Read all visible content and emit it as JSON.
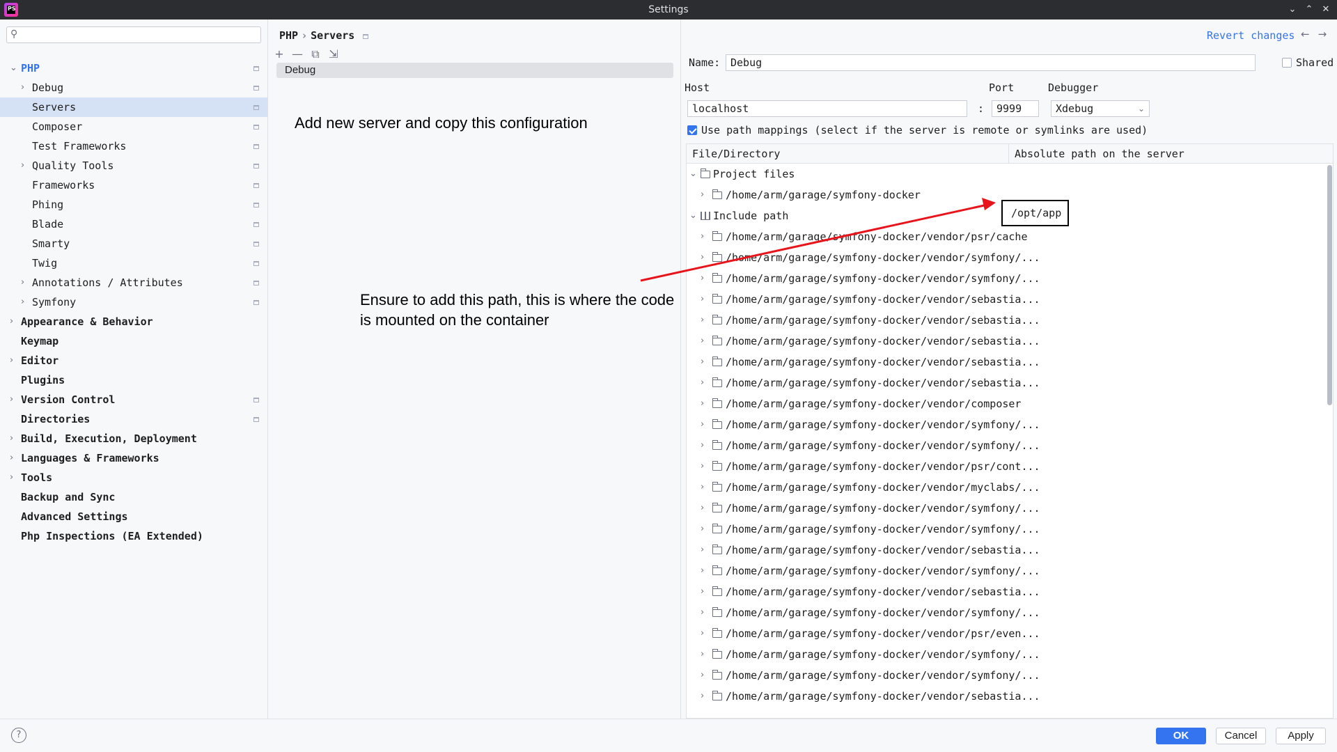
{
  "window": {
    "title": "Settings",
    "app_icon_text": "PS",
    "controls": [
      "⌄",
      "⌃",
      "✕"
    ]
  },
  "sidebar": {
    "search_placeholder": "",
    "items": [
      {
        "label": "PHP",
        "expanded": true,
        "level": 0,
        "style": "accent",
        "pinned": true
      },
      {
        "label": "Debug",
        "expandable": true,
        "level": 1,
        "pinned": true
      },
      {
        "label": "Servers",
        "level": 1,
        "selected": true,
        "pinned": true
      },
      {
        "label": "Composer",
        "level": 1,
        "pinned": true
      },
      {
        "label": "Test Frameworks",
        "level": 1,
        "pinned": true
      },
      {
        "label": "Quality Tools",
        "expandable": true,
        "level": 1,
        "pinned": true
      },
      {
        "label": "Frameworks",
        "level": 1,
        "pinned": true
      },
      {
        "label": "Phing",
        "level": 1,
        "pinned": true
      },
      {
        "label": "Blade",
        "level": 1,
        "pinned": true
      },
      {
        "label": "Smarty",
        "level": 1,
        "pinned": true
      },
      {
        "label": "Twig",
        "level": 1,
        "pinned": true
      },
      {
        "label": "Annotations / Attributes",
        "expandable": true,
        "level": 1,
        "pinned": true
      },
      {
        "label": "Symfony",
        "expandable": true,
        "level": 1,
        "pinned": true
      },
      {
        "label": "Appearance & Behavior",
        "expandable": true,
        "level": 0,
        "style": "bold"
      },
      {
        "label": "Keymap",
        "level": 0,
        "style": "bold"
      },
      {
        "label": "Editor",
        "expandable": true,
        "level": 0,
        "style": "bold"
      },
      {
        "label": "Plugins",
        "level": 0,
        "style": "bold"
      },
      {
        "label": "Version Control",
        "expandable": true,
        "level": 0,
        "style": "bold",
        "pinned": true
      },
      {
        "label": "Directories",
        "level": 0,
        "style": "bold",
        "pinned": true
      },
      {
        "label": "Build, Execution, Deployment",
        "expandable": true,
        "level": 0,
        "style": "bold"
      },
      {
        "label": "Languages & Frameworks",
        "expandable": true,
        "level": 0,
        "style": "bold"
      },
      {
        "label": "Tools",
        "expandable": true,
        "level": 0,
        "style": "bold"
      },
      {
        "label": "Backup and Sync",
        "level": 0,
        "style": "bold"
      },
      {
        "label": "Advanced Settings",
        "level": 0,
        "style": "bold"
      },
      {
        "label": "Php Inspections (EA Extended)",
        "level": 0,
        "style": "bold"
      }
    ]
  },
  "breadcrumb": {
    "parent": "PHP",
    "separator": "›",
    "current": "Servers"
  },
  "middle": {
    "toolbar": [
      "+",
      "—",
      "⧉",
      "⇲"
    ],
    "server_item": "Debug"
  },
  "annotations": {
    "copy_config": "Add new server and copy this configuration",
    "path_note_line1": "Ensure to add this path, this is where the code",
    "path_note_line2": "is mounted on the container"
  },
  "form": {
    "revert_label": "Revert changes",
    "name_label": "Name:",
    "name_value": "Debug",
    "shared_label": "Shared",
    "shared_checked": false,
    "host_label": "Host",
    "host_value": "localhost",
    "port_label": "Port",
    "port_value": "9999",
    "colon": ":",
    "debugger_label": "Debugger",
    "debugger_value": "Xdebug",
    "use_mappings_label": "Use path mappings (select if the server is remote or symlinks are used)",
    "use_mappings_checked": true
  },
  "mappings": {
    "col_file": "File/Directory",
    "col_server": "Absolute path on the server",
    "project_files_label": "Project files",
    "project_path": "/home/arm/garage/symfony-docker",
    "server_path": "/opt/app",
    "include_path_label": "Include path",
    "include_paths": [
      "/home/arm/garage/symfony-docker/vendor/psr/cache",
      "/home/arm/garage/symfony-docker/vendor/symfony/...",
      "/home/arm/garage/symfony-docker/vendor/symfony/...",
      "/home/arm/garage/symfony-docker/vendor/sebastia...",
      "/home/arm/garage/symfony-docker/vendor/sebastia...",
      "/home/arm/garage/symfony-docker/vendor/sebastia...",
      "/home/arm/garage/symfony-docker/vendor/sebastia...",
      "/home/arm/garage/symfony-docker/vendor/sebastia...",
      "/home/arm/garage/symfony-docker/vendor/composer",
      "/home/arm/garage/symfony-docker/vendor/symfony/...",
      "/home/arm/garage/symfony-docker/vendor/symfony/...",
      "/home/arm/garage/symfony-docker/vendor/psr/cont...",
      "/home/arm/garage/symfony-docker/vendor/myclabs/...",
      "/home/arm/garage/symfony-docker/vendor/symfony/...",
      "/home/arm/garage/symfony-docker/vendor/symfony/...",
      "/home/arm/garage/symfony-docker/vendor/sebastia...",
      "/home/arm/garage/symfony-docker/vendor/symfony/...",
      "/home/arm/garage/symfony-docker/vendor/sebastia...",
      "/home/arm/garage/symfony-docker/vendor/symfony/...",
      "/home/arm/garage/symfony-docker/vendor/psr/even...",
      "/home/arm/garage/symfony-docker/vendor/symfony/...",
      "/home/arm/garage/symfony-docker/vendor/symfony/...",
      "/home/arm/garage/symfony-docker/vendor/sebastia..."
    ]
  },
  "footer": {
    "help": "?",
    "ok": "OK",
    "cancel": "Cancel",
    "apply": "Apply"
  },
  "colors": {
    "accent": "#3574f0",
    "selection": "#d5e1f5",
    "annotation_arrow": "#e8141c"
  }
}
